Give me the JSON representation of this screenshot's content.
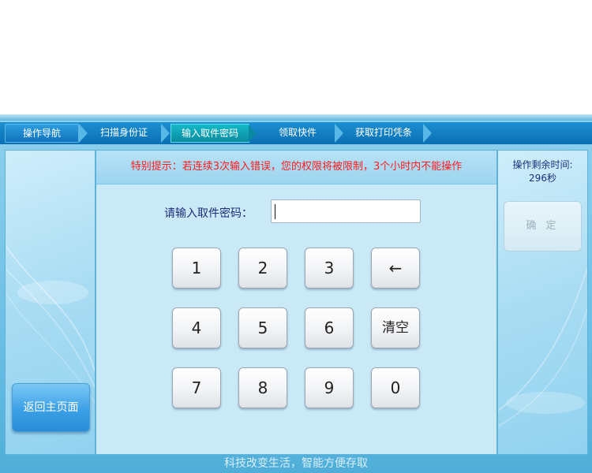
{
  "nav": {
    "steps": [
      {
        "label": "操作导航"
      },
      {
        "label": "扫描身份证"
      },
      {
        "label": "输入取件密码"
      },
      {
        "label": "领取快件"
      },
      {
        "label": "获取打印凭条"
      }
    ],
    "active_index": 2
  },
  "warning": {
    "text": "特别提示：若连续3次输入错误，您的权限将被限制，3个小时内不能操作"
  },
  "password": {
    "label": "请输入取件密码：",
    "value": ""
  },
  "keypad": {
    "keys": [
      "1",
      "2",
      "3",
      "←",
      "4",
      "5",
      "6",
      "清空",
      "7",
      "8",
      "9",
      "0"
    ]
  },
  "left_panel": {
    "back_label": "返回主页面"
  },
  "right_panel": {
    "timer_label": "操作剩余时间:",
    "timer_value": "296秒",
    "confirm_label": "确 定"
  },
  "footer": {
    "slogan": "科技改变生活，智能方便存取"
  },
  "colors": {
    "warning_text": "#ff1a1a",
    "nav_bar": "#0b6fb5",
    "nav_active": "#0a8aa0",
    "back_button": "#3ba0e6"
  }
}
